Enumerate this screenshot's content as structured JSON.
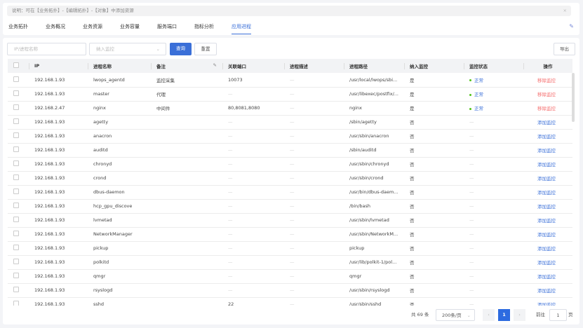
{
  "notice": {
    "text": "说明：可在【业务拓扑】-【编辑拓扑】-【对象】中添加资源",
    "close": "×"
  },
  "tabs": [
    "业务拓扑",
    "业务概况",
    "业务资源",
    "业务容量",
    "服务端口",
    "指标分析",
    "应用进程"
  ],
  "active_tab": "应用进程",
  "filters": {
    "search_placeholder": "IP/进程名称",
    "monitor_placeholder": "纳入监控",
    "query": "查询",
    "reset": "重置",
    "export": "导出"
  },
  "columns": [
    "IP",
    "进程名称",
    "备注",
    "关联端口",
    "进程描述",
    "进程路径",
    "纳入监控",
    "监控状态",
    "操作"
  ],
  "rows": [
    [
      "192.168.1.93",
      "lwops_agentd",
      "监控采集",
      "10073",
      "—",
      "/usr/local/lwops/sbi...",
      "是",
      "正常",
      "移除监控"
    ],
    [
      "192.168.1.93",
      "master",
      "代理",
      "—",
      "—",
      "/usr/libexec/postfix/...",
      "是",
      "正常",
      "移除监控"
    ],
    [
      "192.168.2.47",
      "nginx",
      "中间件",
      "80,8081,8080",
      "—",
      "nginx",
      "是",
      "正常",
      "移除监控"
    ],
    [
      "192.168.1.93",
      "agetty",
      "",
      "—",
      "—",
      "/sbin/agetty",
      "否",
      "—",
      "添加监控"
    ],
    [
      "192.168.1.93",
      "anacron",
      "",
      "—",
      "—",
      "/usr/sbin/anacron",
      "否",
      "—",
      "添加监控"
    ],
    [
      "192.168.1.93",
      "auditd",
      "",
      "—",
      "—",
      "/sbin/auditd",
      "否",
      "—",
      "添加监控"
    ],
    [
      "192.168.1.93",
      "chronyd",
      "",
      "—",
      "—",
      "/usr/sbin/chronyd",
      "否",
      "—",
      "添加监控"
    ],
    [
      "192.168.1.93",
      "crond",
      "",
      "—",
      "—",
      "/usr/sbin/crond",
      "否",
      "—",
      "添加监控"
    ],
    [
      "192.168.1.93",
      "dbus-daemon",
      "",
      "—",
      "—",
      "/usr/bin/dbus-daem...",
      "否",
      "—",
      "添加监控"
    ],
    [
      "192.168.1.93",
      "hcp_gpu_discove",
      "",
      "—",
      "—",
      "/bin/bash",
      "否",
      "—",
      "添加监控"
    ],
    [
      "192.168.1.93",
      "lvmetad",
      "",
      "—",
      "—",
      "/usr/sbin/lvmetad",
      "否",
      "—",
      "添加监控"
    ],
    [
      "192.168.1.93",
      "NetworkManager",
      "",
      "—",
      "—",
      "/usr/sbin/NetworkM...",
      "否",
      "—",
      "添加监控"
    ],
    [
      "192.168.1.93",
      "pickup",
      "",
      "—",
      "—",
      "pickup",
      "否",
      "—",
      "添加监控"
    ],
    [
      "192.168.1.93",
      "polkitd",
      "",
      "—",
      "—",
      "/usr/lib/polkit-1/pol...",
      "否",
      "—",
      "添加监控"
    ],
    [
      "192.168.1.93",
      "qmgr",
      "",
      "—",
      "—",
      "qmgr",
      "否",
      "—",
      "添加监控"
    ],
    [
      "192.168.1.93",
      "rsyslogd",
      "",
      "—",
      "—",
      "/usr/sbin/rsyslogd",
      "否",
      "—",
      "添加监控"
    ],
    [
      "192.168.1.93",
      "sshd",
      "",
      "22",
      "—",
      "/usr/sbin/sshd",
      "否",
      "—",
      "添加监控"
    ]
  ],
  "pagination": {
    "total": "共 69 条",
    "page_size": "200条/页",
    "current": "1",
    "goto_label": "前往",
    "goto_value": "1",
    "page_suffix": "页"
  }
}
